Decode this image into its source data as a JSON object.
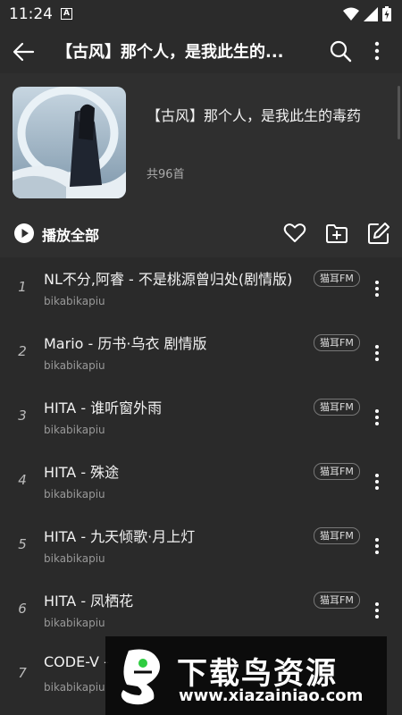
{
  "status_bar": {
    "time": "11:24",
    "notification_letter": "A"
  },
  "app_bar": {
    "title": "【古风】那个人，是我此生的..."
  },
  "playlist": {
    "name": "【古风】那个人，是我此生的毒药",
    "count": "共96首"
  },
  "actions": {
    "play_all": "播放全部"
  },
  "songs": [
    {
      "index": "1",
      "title": "NL不分,阿睿 - 不是桃源曾归处(剧情版)",
      "artist": "bikabikapiu",
      "badge": "猫耳FM"
    },
    {
      "index": "2",
      "title": "Mario - 历书·乌衣 剧情版",
      "artist": "bikabikapiu",
      "badge": "猫耳FM"
    },
    {
      "index": "3",
      "title": "HITA - 谁听窗外雨",
      "artist": "bikabikapiu",
      "badge": "猫耳FM"
    },
    {
      "index": "4",
      "title": "HITA - 殊途",
      "artist": "bikabikapiu",
      "badge": "猫耳FM"
    },
    {
      "index": "5",
      "title": "HITA - 九天倾歌·月上灯",
      "artist": "bikabikapiu",
      "badge": "猫耳FM"
    },
    {
      "index": "6",
      "title": "HITA - 凤栖花",
      "artist": "bikabikapiu",
      "badge": "猫耳FM"
    },
    {
      "index": "7",
      "title": "CODE-V -",
      "artist": "bikabikapiu",
      "badge": ""
    }
  ],
  "watermark": {
    "title": "下载鸟资源",
    "url": "www.xiazainiao.com"
  },
  "colors": {
    "background": "#2b2b2b",
    "list_background": "#2a2a2a",
    "text": "#f2f2f2",
    "muted": "#999999"
  }
}
